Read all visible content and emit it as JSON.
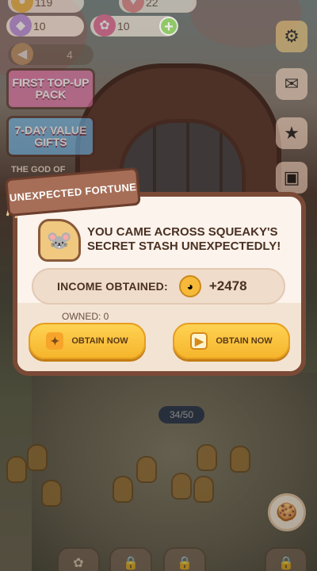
{
  "hud": {
    "gems_value": "10",
    "candy_value": "10",
    "top_left_value": "119",
    "top_right_value": "22",
    "alert_count": "4"
  },
  "promos": {
    "first_topup": "FIRST TOP-UP PACK",
    "seven_day": "7-DAY VALUE GIFTS",
    "god_of": "THE GOD OF"
  },
  "dialog": {
    "tag_title": "UNEXPECTED FORTUNE",
    "headline": "YOU CAME ACROSS SQUEAKY'S SECRET STASH UNEXPECTEDLY!",
    "income_label": "INCOME OBTAINED:",
    "income_value": "+2478",
    "owned_text": "OWNED: 0",
    "obtain_now_left": "OBTAIN NOW",
    "obtain_now_right": "OBTAIN NOW"
  },
  "scene": {
    "capacity": "34/50"
  },
  "icons": {
    "gem": "gem-icon",
    "candy": "candy-icon",
    "add": "plus-icon",
    "settings": "gear-icon",
    "coin": "coin-icon",
    "video": "video-icon",
    "ticket": "ticket-icon"
  },
  "colors": {
    "button_yellow": "#f5b52c",
    "dialog_border": "#7a4a36",
    "add_green": "#7ccf4a",
    "dialog_bg": "#fbf3ec"
  }
}
